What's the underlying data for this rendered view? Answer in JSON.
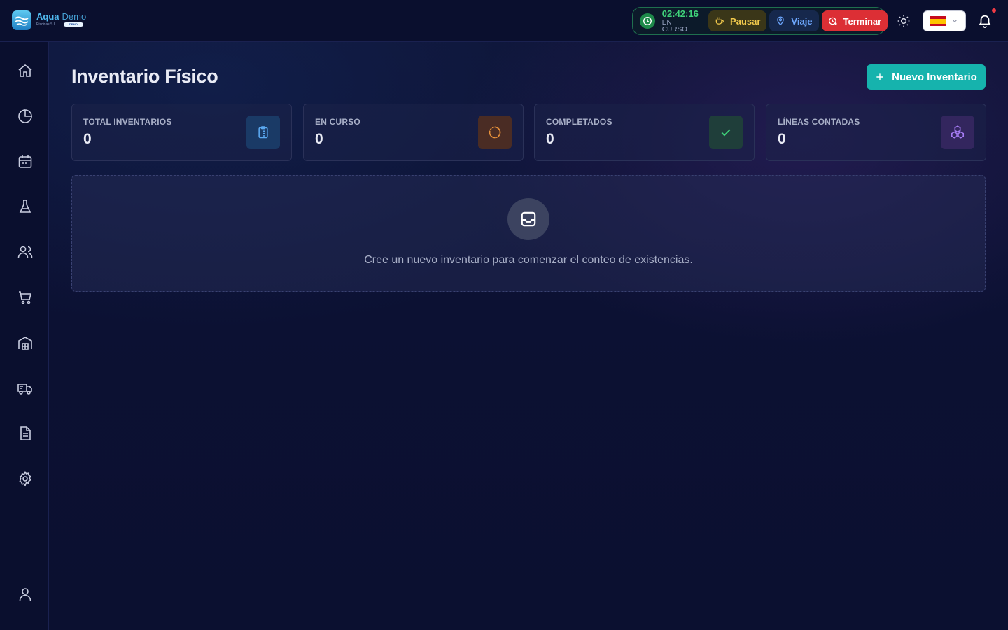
{
  "brand": {
    "name": "Aqua",
    "tag": "Demo",
    "subtitle": "Piscinas S.L.",
    "badge": "DEMO"
  },
  "session": {
    "timer": "02:42:16",
    "status": "EN CURSO",
    "pause_label": "Pausar",
    "trip_label": "Viaje",
    "end_label": "Terminar"
  },
  "language": {
    "selected": "Español"
  },
  "sidebar": {
    "items": [
      {
        "id": "home",
        "icon": "home-icon"
      },
      {
        "id": "reports",
        "icon": "pie-chart-icon"
      },
      {
        "id": "calendar",
        "icon": "calendar-icon"
      },
      {
        "id": "lab",
        "icon": "flask-icon"
      },
      {
        "id": "customers",
        "icon": "users-icon"
      },
      {
        "id": "shop",
        "icon": "cart-icon"
      },
      {
        "id": "warehouse",
        "icon": "warehouse-icon"
      },
      {
        "id": "delivery",
        "icon": "truck-icon"
      },
      {
        "id": "documents",
        "icon": "document-icon"
      },
      {
        "id": "settings",
        "icon": "gear-icon"
      },
      {
        "id": "profile",
        "icon": "user-icon"
      }
    ]
  },
  "page": {
    "title": "Inventario Físico",
    "new_button": "Nuevo Inventario"
  },
  "stats": [
    {
      "label": "TOTAL INVENTARIOS",
      "value": "0",
      "icon": "clipboard-icon",
      "accent": "#5aa8f0"
    },
    {
      "label": "EN CURSO",
      "value": "0",
      "icon": "loader-icon",
      "accent": "#e8913a"
    },
    {
      "label": "COMPLETADOS",
      "value": "0",
      "icon": "check-icon",
      "accent": "#3fd27a"
    },
    {
      "label": "LÍNEAS CONTADAS",
      "value": "0",
      "icon": "boxes-icon",
      "accent": "#a77cf5"
    }
  ],
  "empty_state": {
    "icon": "inbox-icon",
    "message": "Cree un nuevo inventario para comenzar el conteo de existencias."
  },
  "colors": {
    "primary": "#16b3ad",
    "danger": "#dc2f35",
    "warning": "#f2c94c",
    "success": "#3fd27a"
  }
}
